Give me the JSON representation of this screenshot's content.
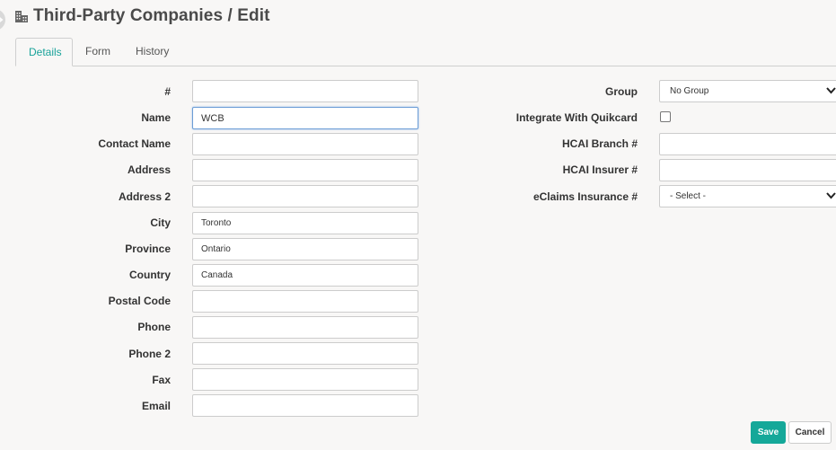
{
  "header": {
    "title": "Third-Party Companies / Edit",
    "icon": "building-icon"
  },
  "tabs": [
    {
      "label": "Details",
      "active": true
    },
    {
      "label": "Form",
      "active": false
    },
    {
      "label": "History",
      "active": false
    }
  ],
  "left_form": {
    "number": {
      "label": "#",
      "value": ""
    },
    "name": {
      "label": "Name",
      "value": "WCB"
    },
    "contact_name": {
      "label": "Contact Name",
      "value": ""
    },
    "address": {
      "label": "Address",
      "value": ""
    },
    "address2": {
      "label": "Address 2",
      "value": ""
    },
    "city": {
      "label": "City",
      "value": "Toronto"
    },
    "province": {
      "label": "Province",
      "value": "Ontario"
    },
    "country": {
      "label": "Country",
      "value": "Canada"
    },
    "postal_code": {
      "label": "Postal Code",
      "value": ""
    },
    "phone": {
      "label": "Phone",
      "value": ""
    },
    "phone2": {
      "label": "Phone 2",
      "value": ""
    },
    "fax": {
      "label": "Fax",
      "value": ""
    },
    "email": {
      "label": "Email",
      "value": ""
    }
  },
  "right_form": {
    "group": {
      "label": "Group",
      "selected": "No Group"
    },
    "integrate_quikcard": {
      "label": "Integrate With Quikcard",
      "checked": false
    },
    "hcai_branch": {
      "label": "HCAI Branch #",
      "value": ""
    },
    "hcai_insurer": {
      "label": "HCAI Insurer #",
      "value": ""
    },
    "eclaims_insurance": {
      "label": "eClaims Insurance #",
      "selected": "- Select -"
    }
  },
  "buttons": {
    "save": "Save",
    "cancel": "Cancel"
  },
  "colors": {
    "accent": "#15a899",
    "active_tab_text": "#1aa39a",
    "background": "#f8f7f6",
    "focus_border": "#6c9dd6"
  }
}
